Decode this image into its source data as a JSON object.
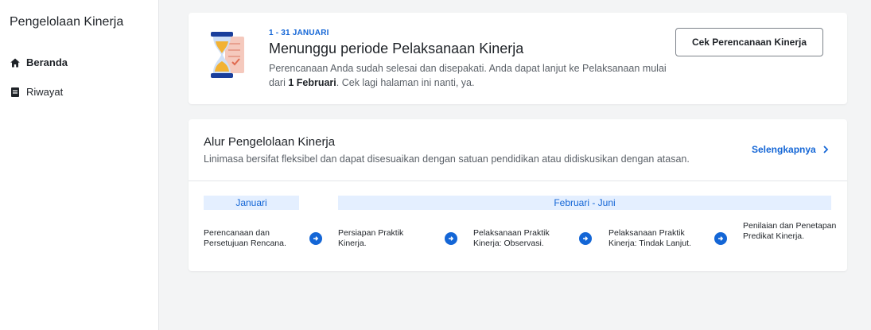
{
  "sidebar": {
    "title": "Pengelolaan Kinerja",
    "items": [
      {
        "label": "Beranda",
        "icon": "home-icon",
        "active": true
      },
      {
        "label": "Riwayat",
        "icon": "document-icon",
        "active": false
      }
    ]
  },
  "status_card": {
    "icon": "hourglass-icon",
    "period": "1 - 31 JANUARI",
    "title": "Menunggu periode Pelaksanaan Kinerja",
    "desc_pre": "Perencanaan Anda sudah selesai dan disepakati. Anda dapat lanjut ke Pelaksanaan mulai dari ",
    "desc_bold": "1 Februari",
    "desc_post": ". Cek lagi halaman ini nanti, ya.",
    "button_label": "Cek Perencanaan Kinerja"
  },
  "flow_card": {
    "title": "Alur Pengelolaan Kinerja",
    "description": "Linimasa bersifat fleksibel dan dapat disesuaikan dengan satuan pendidikan atau didiskusikan dengan atasan.",
    "link_label": "Selengkapnya",
    "months": [
      "Januari",
      "Februari - Juni"
    ],
    "steps": [
      "Perencanaan dan Persetujuan Rencana.",
      "Persiapan Praktik Kinerja.",
      "Pelaksanaan Praktik Kinerja: Observasi.",
      "Pelaksanaan Praktik Kinerja: Tindak Lanjut.",
      "Penilaian dan Penetapan Predikat Kinerja."
    ]
  },
  "colors": {
    "accent": "#1466d6",
    "month_bg": "#e4efff",
    "page_bg": "#f3f4f5"
  }
}
